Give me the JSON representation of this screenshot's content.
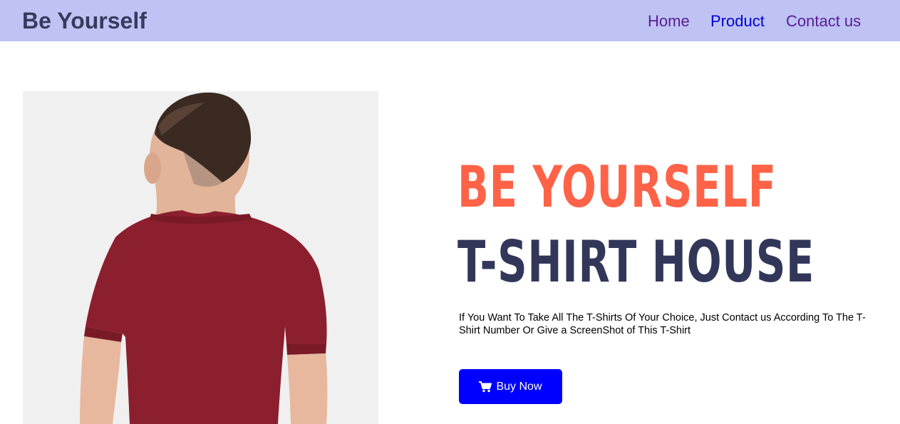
{
  "navbar": {
    "brand": "Be Yourself",
    "links": [
      "Home",
      "Product",
      "Contact us"
    ]
  },
  "hero": {
    "image": "man-in-red-tshirt-back-view",
    "heading_1": "BE YOURSELF",
    "heading_2": "T-SHIRT HOUSE",
    "description": "If You Want To Take All The T-Shirts Of Your Choice, Just Contact us According To The T-Shirt Number Or Give a ScreenShot of This T-Shirt",
    "button": {
      "icon": "cart-icon",
      "label": "Buy Now"
    }
  },
  "colors": {
    "navbar_bg": "#bec3f4",
    "brand": "#363b5e",
    "accent_orange": "#ff6347",
    "heading_dark": "#32375a",
    "button": "#0000ff"
  }
}
